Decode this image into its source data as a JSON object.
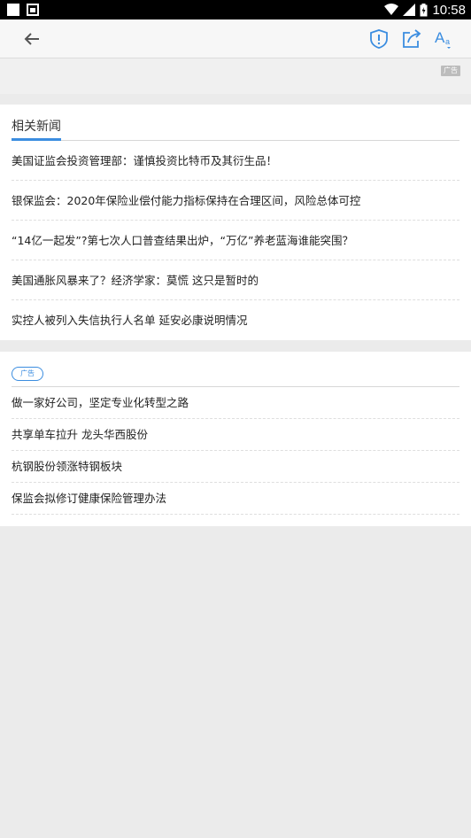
{
  "status_bar": {
    "time": "10:58"
  },
  "toolbar": {
    "back_icon": "arrow-left-icon",
    "report_icon": "shield-alert-icon",
    "share_icon": "share-icon",
    "font_icon": "font-size-icon",
    "font_icon_text": "A",
    "accent_color": "#3b8de0"
  },
  "top_ad": {
    "label": "广告"
  },
  "related_news": {
    "title": "相关新闻",
    "items": [
      "美国证监会投资管理部：谨慎投资比特币及其衍生品！",
      "银保监会：2020年保险业偿付能力指标保持在合理区间，风险总体可控",
      "“14亿一起发”?第七次人口普查结果出炉，“万亿”养老蓝海谁能突围？",
      "美国通胀风暴来了？经济学家：莫慌 这只是暂时的",
      "实控人被列入失信执行人名单 延安必康说明情况"
    ]
  },
  "ad_section": {
    "badge": "广告",
    "items": [
      "做一家好公司，坚定专业化转型之路",
      "共享单车拉升 龙头华西股份",
      "杭钢股份领涨特钢板块",
      "保监会拟修订健康保险管理办法"
    ]
  }
}
